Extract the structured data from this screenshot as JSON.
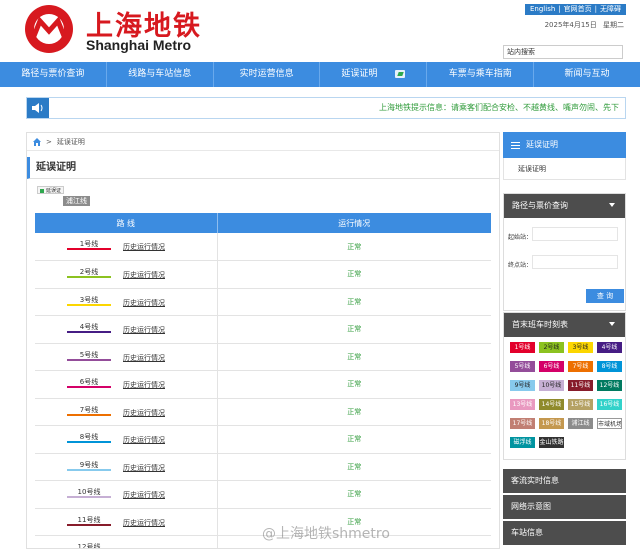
{
  "header": {
    "logo_cn": "上海地铁",
    "logo_en": "Shanghai Metro",
    "top_links": [
      "English",
      "|",
      "官网首页",
      "|",
      "无障碍"
    ],
    "date": "2025年4月15日",
    "weekday": "星期二",
    "search_placeholder": "站内搜索"
  },
  "nav": {
    "items": [
      "路径与票价查询",
      "线路与车站信息",
      "实时运营信息",
      "延误证明",
      "车票与乘车指南",
      "新闻与互动"
    ]
  },
  "notice": {
    "text": "上海地铁提示信息：请乘客们配合安检、不越黄线、嘴声勿闹、先下"
  },
  "breadcrumb": {
    "current": "延误证明"
  },
  "page_title": "延误证明",
  "legend_badge": "延误证",
  "line_tag": "浦江线",
  "table": {
    "headers": [
      "路 线",
      "运行情况"
    ],
    "rows": [
      {
        "line": "1号线",
        "color": "#e3002b",
        "link": "历史运行情况",
        "status": "正常"
      },
      {
        "line": "2号线",
        "color": "#8cc220",
        "link": "历史运行情况",
        "status": "正常"
      },
      {
        "line": "3号线",
        "color": "#fcd600",
        "link": "历史运行情况",
        "status": "正常"
      },
      {
        "line": "4号线",
        "color": "#461d84",
        "link": "历史运行情况",
        "status": "正常"
      },
      {
        "line": "5号线",
        "color": "#944d9a",
        "link": "历史运行情况",
        "status": "正常"
      },
      {
        "line": "6号线",
        "color": "#d40068",
        "link": "历史运行情况",
        "status": "正常"
      },
      {
        "line": "7号线",
        "color": "#ed6f00",
        "link": "历史运行情况",
        "status": "正常"
      },
      {
        "line": "8号线",
        "color": "#0094d8",
        "link": "历史运行情况",
        "status": "正常"
      },
      {
        "line": "9号线",
        "color": "#87caed",
        "link": "历史运行情况",
        "status": "正常"
      },
      {
        "line": "10号线",
        "color": "#c6afd4",
        "link": "历史运行情况",
        "status": "正常"
      },
      {
        "line": "11号线",
        "color": "#871c2b",
        "link": "历史运行情况",
        "status": "正常"
      },
      {
        "line": "12号线",
        "color": "#007a60",
        "link": "",
        "status": ""
      }
    ]
  },
  "sidebar": {
    "section_title": "延误证明",
    "section_item": "延误证明",
    "route_title": "路径与票价查询",
    "origin_label": "起始站：",
    "dest_label": "终点站：",
    "query_button": "查 询",
    "schedule_title": "首末班车时刻表",
    "chips": [
      {
        "label": "1号线",
        "color": "#e3002b"
      },
      {
        "label": "2号线",
        "color": "#8cc220"
      },
      {
        "label": "3号线",
        "color": "#fcd600"
      },
      {
        "label": "4号线",
        "color": "#461d84"
      },
      {
        "label": "5号线",
        "color": "#944d9a"
      },
      {
        "label": "6号线",
        "color": "#d40068"
      },
      {
        "label": "7号线",
        "color": "#ed6f00"
      },
      {
        "label": "8号线",
        "color": "#0094d8"
      },
      {
        "label": "9号线",
        "color": "#87caed"
      },
      {
        "label": "10号线",
        "color": "#c6afd4"
      },
      {
        "label": "11号线",
        "color": "#871c2b"
      },
      {
        "label": "12号线",
        "color": "#007a60"
      },
      {
        "label": "13号线",
        "color": "#e999c0"
      },
      {
        "label": "14号线",
        "color": "#8f8a2b"
      },
      {
        "label": "15号线",
        "color": "#b5a264"
      },
      {
        "label": "16号线",
        "color": "#32d2ca"
      },
      {
        "label": "17号线",
        "color": "#c17f73"
      },
      {
        "label": "18号线",
        "color": "#c4984f"
      },
      {
        "label": "浦江线",
        "color": "#8c8c8c"
      },
      {
        "label": "市域机场线",
        "color": "#ffffff"
      },
      {
        "label": "磁浮线",
        "color": "#0094a0"
      },
      {
        "label": "金山铁路",
        "color": "#333333"
      }
    ],
    "links": [
      "客流实时信息",
      "网络示意图",
      "车站信息"
    ]
  },
  "watermark": "@上海地铁shmetro"
}
